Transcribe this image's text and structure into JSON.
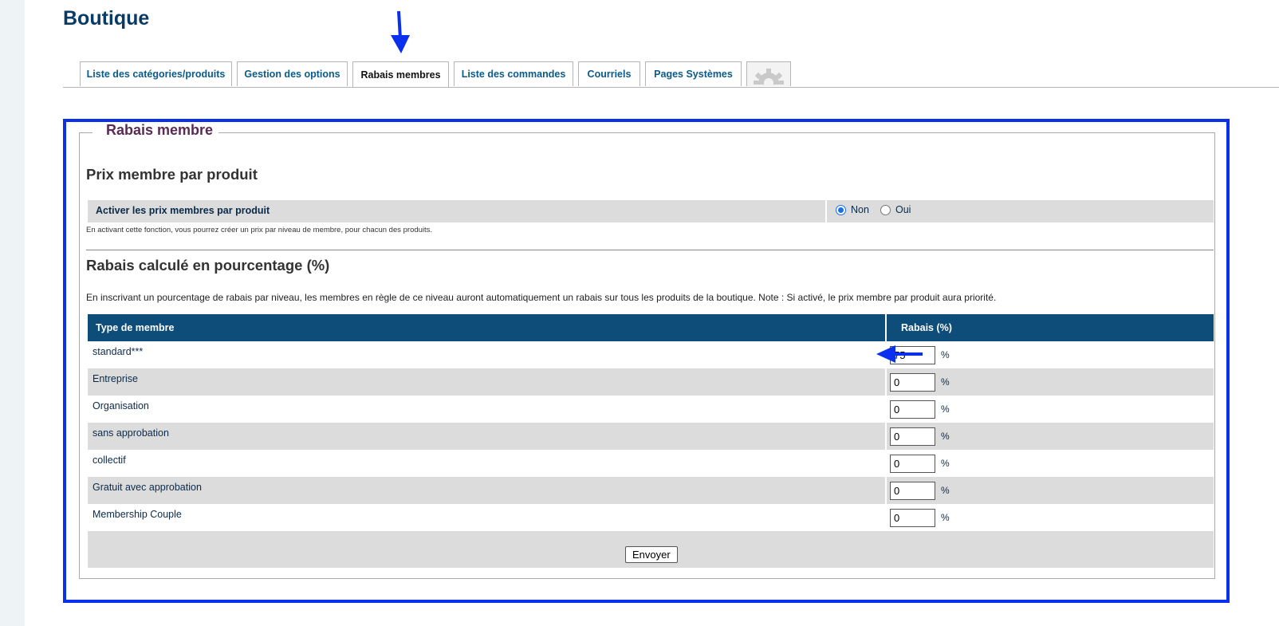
{
  "page": {
    "title": "Boutique"
  },
  "tabs": [
    {
      "label": "Liste des catégories/produits",
      "active": false
    },
    {
      "label": "Gestion des options",
      "active": false
    },
    {
      "label": "Rabais membres",
      "active": true
    },
    {
      "label": "Liste des commandes",
      "active": false
    },
    {
      "label": "Courriels",
      "active": false
    },
    {
      "label": "Pages Systèmes",
      "active": false
    }
  ],
  "panel": {
    "legend": "Rabais membre",
    "product_price": {
      "heading": "Prix membre par produit",
      "activate_label": "Activer les prix membres par produit",
      "options": [
        {
          "label": "Non",
          "checked": true
        },
        {
          "label": "Oui",
          "checked": false
        }
      ],
      "note": "En activant cette fonction, vous pourrez créer un prix par niveau de membre, pour chacun des produits."
    },
    "percent": {
      "heading": "Rabais calculé en pourcentage (%)",
      "description": "En inscrivant un pourcentage de rabais par niveau, les membres en règle de ce niveau auront automatiquement un rabais sur tous les produits de la boutique. Note : Si activé, le prix membre par produit aura priorité.",
      "columns": [
        "Type de membre",
        "Rabais (%)"
      ],
      "unit": "%",
      "rows": [
        {
          "type": "standard***",
          "value": "75"
        },
        {
          "type": "Entreprise",
          "value": "0"
        },
        {
          "type": "Organisation",
          "value": "0"
        },
        {
          "type": "sans approbation",
          "value": "0"
        },
        {
          "type": "collectif",
          "value": "0"
        },
        {
          "type": "Gratuit avec approbation",
          "value": "0"
        },
        {
          "type": "Membership Couple",
          "value": "0"
        }
      ],
      "submit_label": "Envoyer"
    }
  },
  "colors": {
    "annotation": "#0a30ee",
    "header": "#0e4c7a",
    "title": "#0a3a66",
    "legend": "#5a2a55"
  }
}
